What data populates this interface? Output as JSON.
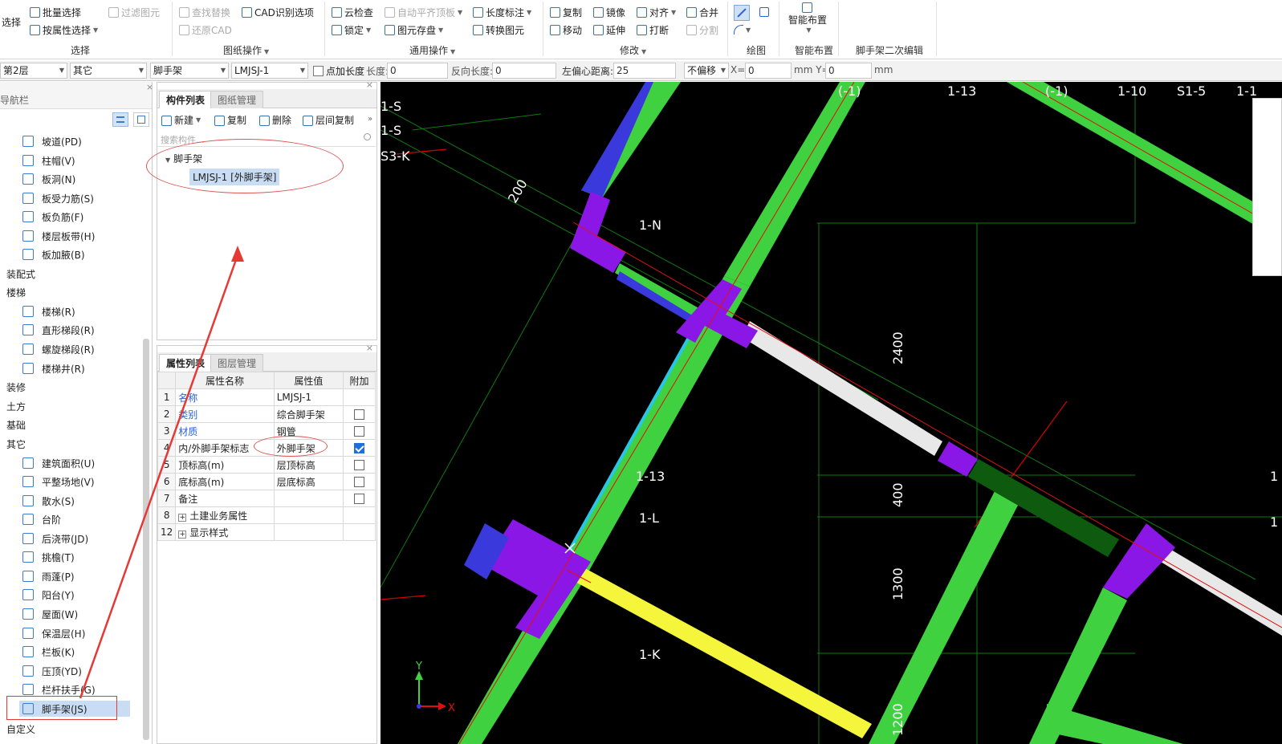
{
  "ribbon": {
    "select": "选择",
    "batch_select": "批量选择",
    "filter": "过滤图元",
    "attr_select": "按属性选择",
    "find_replace": "查找替换",
    "cad_options": "CAD识别选项",
    "restore_cad": "还原CAD",
    "cloud_check": "云检查",
    "auto_floor": "自动平齐顶板",
    "length_mark": "长度标注",
    "lock": "锁定",
    "save_element": "图元存盘",
    "convert_element": "转换图元",
    "copy": "复制",
    "mirror": "镜像",
    "align": "对齐",
    "merge": "合并",
    "move": "移动",
    "extend": "延伸",
    "break": "打断",
    "split": "分割",
    "smart_layout": "智能布置",
    "groups": {
      "select": "选择",
      "drawing_ops": "图纸操作",
      "common_ops": "通用操作",
      "modify": "修改",
      "draw": "绘图",
      "smart": "智能布置",
      "scaffold_edit": "脚手架二次编辑"
    }
  },
  "propbar": {
    "floor": "第2层",
    "category": "其它",
    "type": "脚手架",
    "component": "LMJSJ-1",
    "point_length_label": "点加长度",
    "length_label": "长度:",
    "length_value": "0",
    "reverse_label": "反向长度:",
    "reverse_value": "0",
    "offset_label": "左偏心距离:",
    "offset_value": "25",
    "no_offset": "不偏移",
    "x_label": "X=",
    "x_value": "0",
    "mm_y": "mm Y=",
    "y_value": "0",
    "mm": "mm"
  },
  "nav": {
    "title": "导航栏",
    "items": [
      {
        "label": "坡道(PD)"
      },
      {
        "label": "柱帽(V)"
      },
      {
        "label": "板洞(N)"
      },
      {
        "label": "板受力筋(S)"
      },
      {
        "label": "板负筋(F)"
      },
      {
        "label": "楼层板带(H)"
      },
      {
        "label": "板加腋(B)"
      }
    ],
    "group_prefab": "装配式",
    "group_stair": "楼梯",
    "stair_items": [
      {
        "label": "楼梯(R)"
      },
      {
        "label": "直形梯段(R)"
      },
      {
        "label": "螺旋梯段(R)"
      },
      {
        "label": "楼梯井(R)"
      }
    ],
    "group_decor": "装修",
    "group_earth": "土方",
    "group_found": "基础",
    "group_other": "其它",
    "other_items": [
      {
        "label": "建筑面积(U)"
      },
      {
        "label": "平整场地(V)"
      },
      {
        "label": "散水(S)"
      },
      {
        "label": "台阶"
      },
      {
        "label": "后浇带(JD)"
      },
      {
        "label": "挑檐(T)"
      },
      {
        "label": "雨蓬(P)"
      },
      {
        "label": "阳台(Y)"
      },
      {
        "label": "屋面(W)"
      },
      {
        "label": "保温层(H)"
      },
      {
        "label": "栏板(K)"
      },
      {
        "label": "压顶(YD)"
      },
      {
        "label": "栏杆扶手(G)"
      },
      {
        "label": "脚手架(JS)"
      }
    ],
    "group_custom": "自定义"
  },
  "component_panel": {
    "tab_list": "构件列表",
    "tab_drawing": "图纸管理",
    "new": "新建",
    "copy": "复制",
    "delete": "删除",
    "floor_copy": "层间复制",
    "search_placeholder": "搜索构件...",
    "tree_root": "脚手架",
    "tree_item": "LMJSJ-1 [外脚手架]"
  },
  "attr_panel": {
    "tab_attr": "属性列表",
    "tab_layer": "图层管理",
    "col_name": "属性名称",
    "col_value": "属性值",
    "col_extra": "附加",
    "rows": [
      {
        "no": "1",
        "name": "名称",
        "value": "LMJSJ-1"
      },
      {
        "no": "2",
        "name": "类别",
        "value": "综合脚手架"
      },
      {
        "no": "3",
        "name": "材质",
        "value": "钢管"
      },
      {
        "no": "4",
        "name": "内/外脚手架标志",
        "value": "外脚手架"
      },
      {
        "no": "5",
        "name": "顶标高(m)",
        "value": "层顶标高"
      },
      {
        "no": "6",
        "name": "底标高(m)",
        "value": "层底标高"
      },
      {
        "no": "7",
        "name": "备注",
        "value": ""
      },
      {
        "no": "8",
        "name": "土建业务属性",
        "value": ""
      },
      {
        "no": "12",
        "name": "显示样式",
        "value": ""
      }
    ]
  },
  "canvas": {
    "labels": {
      "a": "1-S",
      "b": "1-S",
      "c": "S3-K",
      "d": "(-1)",
      "e": "1-13",
      "f": "(-1)",
      "g": "1-10",
      "h": "S1-5",
      "i": "1-1",
      "j": "1-N",
      "k": "1-13",
      "l": "1-L",
      "m": "1-K",
      "dim1": "200",
      "dim2": "2400",
      "dim3": "400",
      "dim4": "1300",
      "dim5": "1200",
      "r1": "1",
      "r2": "1",
      "ux": "X",
      "uy": "Y"
    }
  }
}
